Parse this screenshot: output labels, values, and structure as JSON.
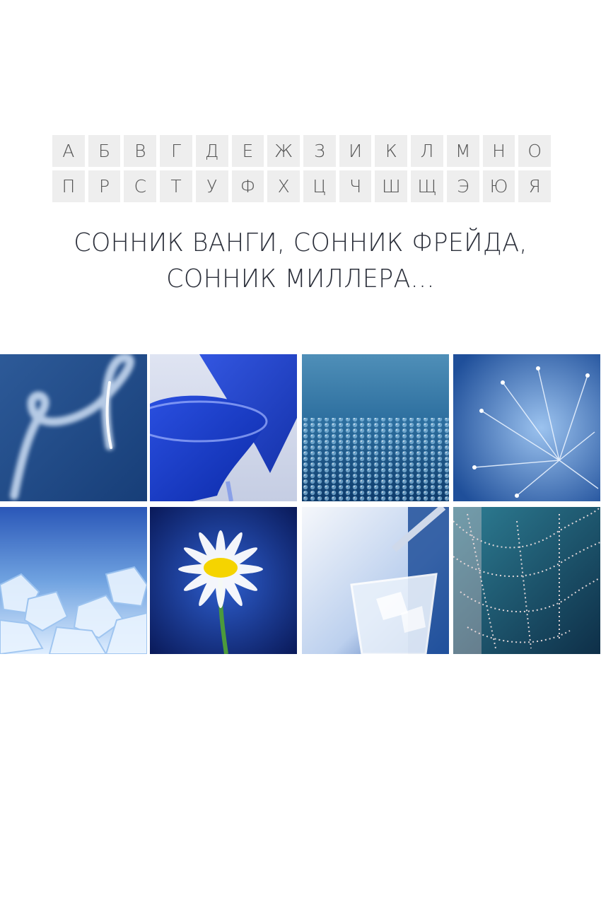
{
  "alphabet": {
    "row1": [
      "А",
      "Б",
      "В",
      "Г",
      "Д",
      "Е",
      "Ж",
      "З",
      "И",
      "К",
      "Л",
      "М",
      "Н",
      "О"
    ],
    "row2": [
      "П",
      "Р",
      "С",
      "Т",
      "У",
      "Ф",
      "Х",
      "Ц",
      "Ч",
      "Ш",
      "Щ",
      "Э",
      "Ю",
      "Я"
    ]
  },
  "headline": {
    "line1": "СОННИК ВАНГИ, СОННИК ФРЕЙДА,",
    "line2": "СОННИК МИЛЛЕРА..."
  },
  "gallery": {
    "tiles": [
      {
        "icon": "smoke-trail-photo"
      },
      {
        "icon": "blue-glasses-photo"
      },
      {
        "icon": "water-drops-photo"
      },
      {
        "icon": "dandelion-photo"
      },
      {
        "icon": "ice-cubes-photo"
      },
      {
        "icon": "daisy-flower-photo"
      },
      {
        "icon": "glass-of-water-photo"
      },
      {
        "icon": "spider-web-photo"
      }
    ]
  },
  "colors": {
    "letter_bg": "#eeeeee",
    "letter_text": "#555555",
    "headline_text": "#2b2f3a",
    "accent_blue": "#1f4f9a"
  }
}
